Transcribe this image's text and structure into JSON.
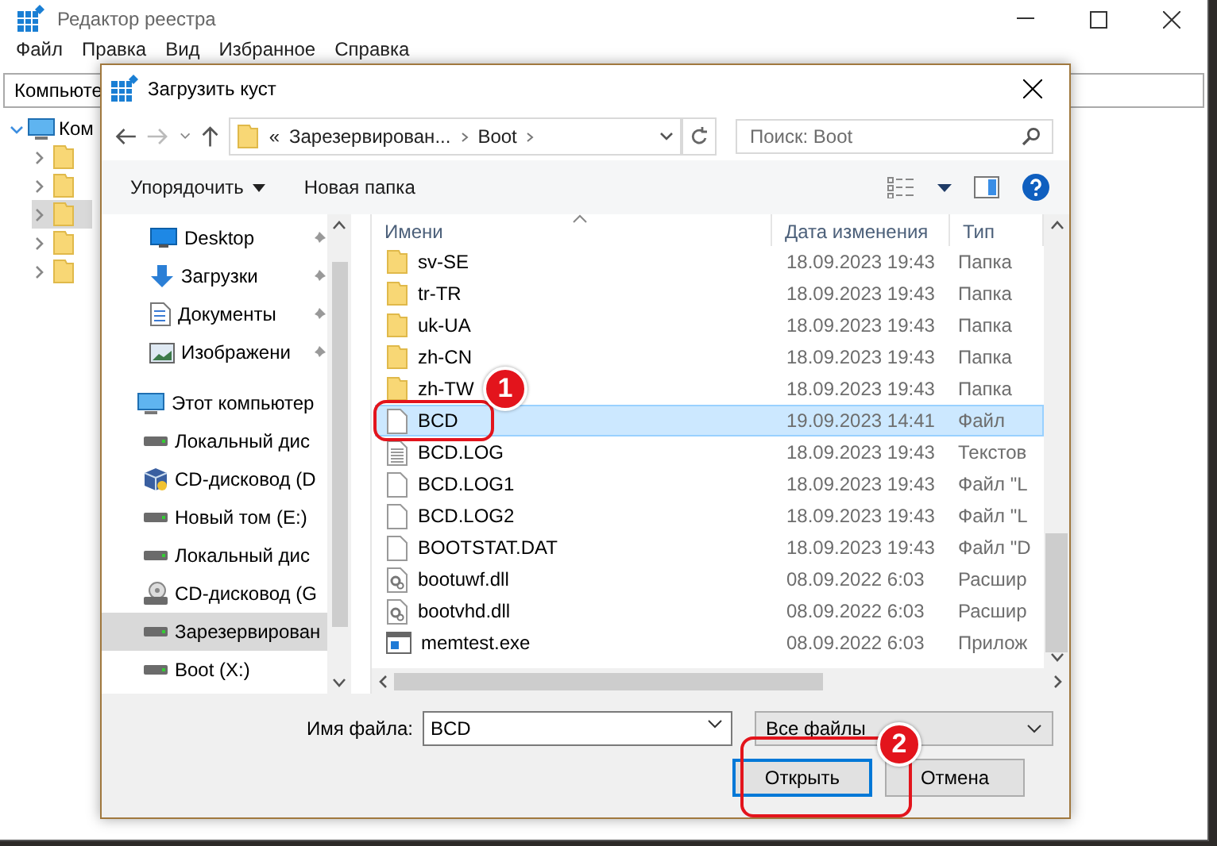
{
  "registry": {
    "title": "Редактор реестра",
    "menu": [
      "Файл",
      "Правка",
      "Вид",
      "Избранное",
      "Справка"
    ],
    "address": "Компьюте",
    "tree": {
      "label": "Ком",
      "expanded": true,
      "children": [
        {
          "expanded": false,
          "selected": false
        },
        {
          "expanded": false,
          "selected": false
        },
        {
          "expanded": false,
          "selected": true
        },
        {
          "expanded": false,
          "selected": false
        },
        {
          "expanded": false,
          "selected": false
        }
      ]
    }
  },
  "dialog": {
    "title": "Загрузить куст",
    "breadcrumb": [
      "«",
      "Зарезервирован...",
      "Boot"
    ],
    "search": {
      "placeholder": "Поиск: Boot"
    },
    "toolbar": [
      "Упорядочить",
      "Новая папка"
    ],
    "nav": [
      {
        "kind": "desktop",
        "label": "Desktop",
        "pinned": true,
        "selected": false
      },
      {
        "kind": "download",
        "label": "Загрузки",
        "pinned": true,
        "selected": false
      },
      {
        "kind": "document",
        "label": "Документы",
        "pinned": true,
        "selected": false
      },
      {
        "kind": "pictures",
        "label": "Изображени",
        "pinned": true,
        "selected": false
      },
      {
        "kind": "computer",
        "label": "Этот компьютер",
        "pinned": false,
        "selected": false
      },
      {
        "kind": "drive",
        "label": "Локальный дис",
        "pinned": false,
        "selected": false
      },
      {
        "kind": "box",
        "label": "CD-дисковод (D",
        "pinned": false,
        "selected": false
      },
      {
        "kind": "drive",
        "label": "Новый том (E:)",
        "pinned": false,
        "selected": false
      },
      {
        "kind": "drive",
        "label": "Локальный дис",
        "pinned": false,
        "selected": false
      },
      {
        "kind": "cd",
        "label": "CD-дисковод (G",
        "pinned": false,
        "selected": false
      },
      {
        "kind": "drive",
        "label": "Зарезервирован",
        "pinned": false,
        "selected": true
      },
      {
        "kind": "drive",
        "label": "Boot (X:)",
        "pinned": false,
        "selected": false
      }
    ],
    "columns": [
      "Имени",
      "Дата изменения",
      "Тип"
    ],
    "files": [
      {
        "kind": "folder",
        "name": "sv-SE",
        "date": "18.09.2023 19:43",
        "type": "Папка",
        "selected": false
      },
      {
        "kind": "folder",
        "name": "tr-TR",
        "date": "18.09.2023 19:43",
        "type": "Папка",
        "selected": false
      },
      {
        "kind": "folder",
        "name": "uk-UA",
        "date": "18.09.2023 19:43",
        "type": "Папка",
        "selected": false
      },
      {
        "kind": "folder",
        "name": "zh-CN",
        "date": "18.09.2023 19:43",
        "type": "Папка",
        "selected": false
      },
      {
        "kind": "folder",
        "name": "zh-TW",
        "date": "18.09.2023 19:43",
        "type": "Папка",
        "selected": false
      },
      {
        "kind": "file",
        "name": "BCD",
        "date": "19.09.2023 14:41",
        "type": "Файл",
        "selected": true
      },
      {
        "kind": "text",
        "name": "BCD.LOG",
        "date": "18.09.2023 19:43",
        "type": "Текстов",
        "selected": false
      },
      {
        "kind": "file",
        "name": "BCD.LOG1",
        "date": "18.09.2023 19:43",
        "type": "Файл \"L",
        "selected": false
      },
      {
        "kind": "file",
        "name": "BCD.LOG2",
        "date": "18.09.2023 19:43",
        "type": "Файл \"L",
        "selected": false
      },
      {
        "kind": "file",
        "name": "BOOTSTAT.DAT",
        "date": "18.09.2023 19:43",
        "type": "Файл \"D",
        "selected": false
      },
      {
        "kind": "dll",
        "name": "bootuwf.dll",
        "date": "08.09.2022 6:03",
        "type": "Расшир",
        "selected": false
      },
      {
        "kind": "dll",
        "name": "bootvhd.dll",
        "date": "08.09.2022 6:03",
        "type": "Расшир",
        "selected": false
      },
      {
        "kind": "exe",
        "name": "memtest.exe",
        "date": "08.09.2022 6:03",
        "type": "Прилож",
        "selected": false
      }
    ],
    "filename_label": "Имя файла:",
    "filename": "BCD",
    "filter": "Все файлы",
    "buttons": [
      "Открыть",
      "Отмена"
    ]
  },
  "annotations": [
    {
      "label": "1"
    },
    {
      "label": "2"
    }
  ]
}
